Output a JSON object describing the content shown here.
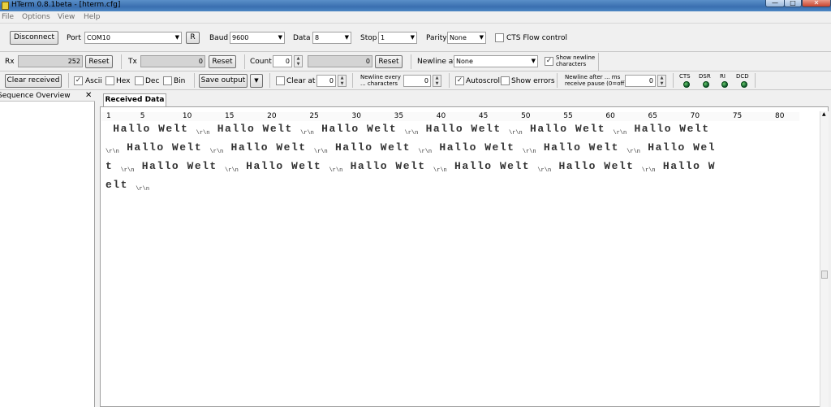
{
  "window": {
    "title": "HTerm 0.8.1beta - [hterm.cfg]",
    "min": "—",
    "max": "□",
    "close": "✕"
  },
  "menu": [
    "File",
    "Options",
    "View",
    "Help"
  ],
  "conn": {
    "disconnect": "Disconnect",
    "port_label": "Port",
    "port": "COM10",
    "r_button": "R",
    "baud_label": "Baud",
    "baud": "9600",
    "data_label": "Data",
    "data": "8",
    "stop_label": "Stop",
    "stop": "1",
    "parity_label": "Parity",
    "parity": "None",
    "cts_label": "CTS Flow control"
  },
  "counters": {
    "rx_label": "Rx",
    "rx_value": "252",
    "rx_reset": "Reset",
    "tx_label": "Tx",
    "tx_value": "0",
    "tx_reset": "Reset",
    "count_label": "Count",
    "count_value": "0",
    "count_display": "0",
    "count_reset": "Reset",
    "newline_at_label": "Newline at",
    "newline_at": "None",
    "show_newline_line1": "Show newline",
    "show_newline_line2": "characters"
  },
  "options": {
    "clear_received": "Clear received",
    "ascii": "Ascii",
    "hex": "Hex",
    "dec": "Dec",
    "bin": "Bin",
    "save_output": "Save output",
    "clear_at": "Clear at",
    "clear_at_value": "0",
    "newline_every_line1": "Newline every",
    "newline_every_line2": "... characters",
    "newline_every_value": "0",
    "autoscroll": "Autoscroll",
    "show_errors": "Show errors",
    "newline_after_line1": "Newline after ... ms",
    "newline_after_line2": "receive pause (0=off)",
    "newline_after_value": "0",
    "leds": [
      "CTS",
      "DSR",
      "RI",
      "DCD"
    ]
  },
  "panel": {
    "sequence_overview": "Sequence Overview",
    "close": "✕"
  },
  "tabs": {
    "received": "Received Data"
  },
  "ruler": [
    "1",
    "5",
    "10",
    "15",
    "20",
    "25",
    "30",
    "35",
    "40",
    "45",
    "50",
    "55",
    "60",
    "65",
    "70",
    "75",
    "80"
  ],
  "received": {
    "lines": [
      [
        " Hallo Welt ",
        "\\r\\n",
        " Hallo Welt ",
        "\\r\\n",
        " Hallo Welt ",
        "\\r\\n",
        " Hallo Welt ",
        "\\r\\n",
        " Hallo Welt ",
        "\\r\\n",
        " Hallo Welt"
      ],
      [
        "\\r\\n",
        " Hallo Welt ",
        "\\r\\n",
        " Hallo Welt ",
        "\\r\\n",
        " Hallo Welt ",
        "\\r\\n",
        " Hallo Welt ",
        "\\r\\n",
        " Hallo Welt ",
        "\\r\\n",
        " Hallo Wel"
      ],
      [
        "t ",
        "\\r\\n",
        " Hallo Welt ",
        "\\r\\n",
        " Hallo Welt ",
        "\\r\\n",
        " Hallo Welt ",
        "\\r\\n",
        " Hallo Welt ",
        "\\r\\n",
        " Hallo Welt ",
        "\\r\\n",
        " Hallo W"
      ],
      [
        "elt ",
        "\\r\\n"
      ]
    ]
  }
}
